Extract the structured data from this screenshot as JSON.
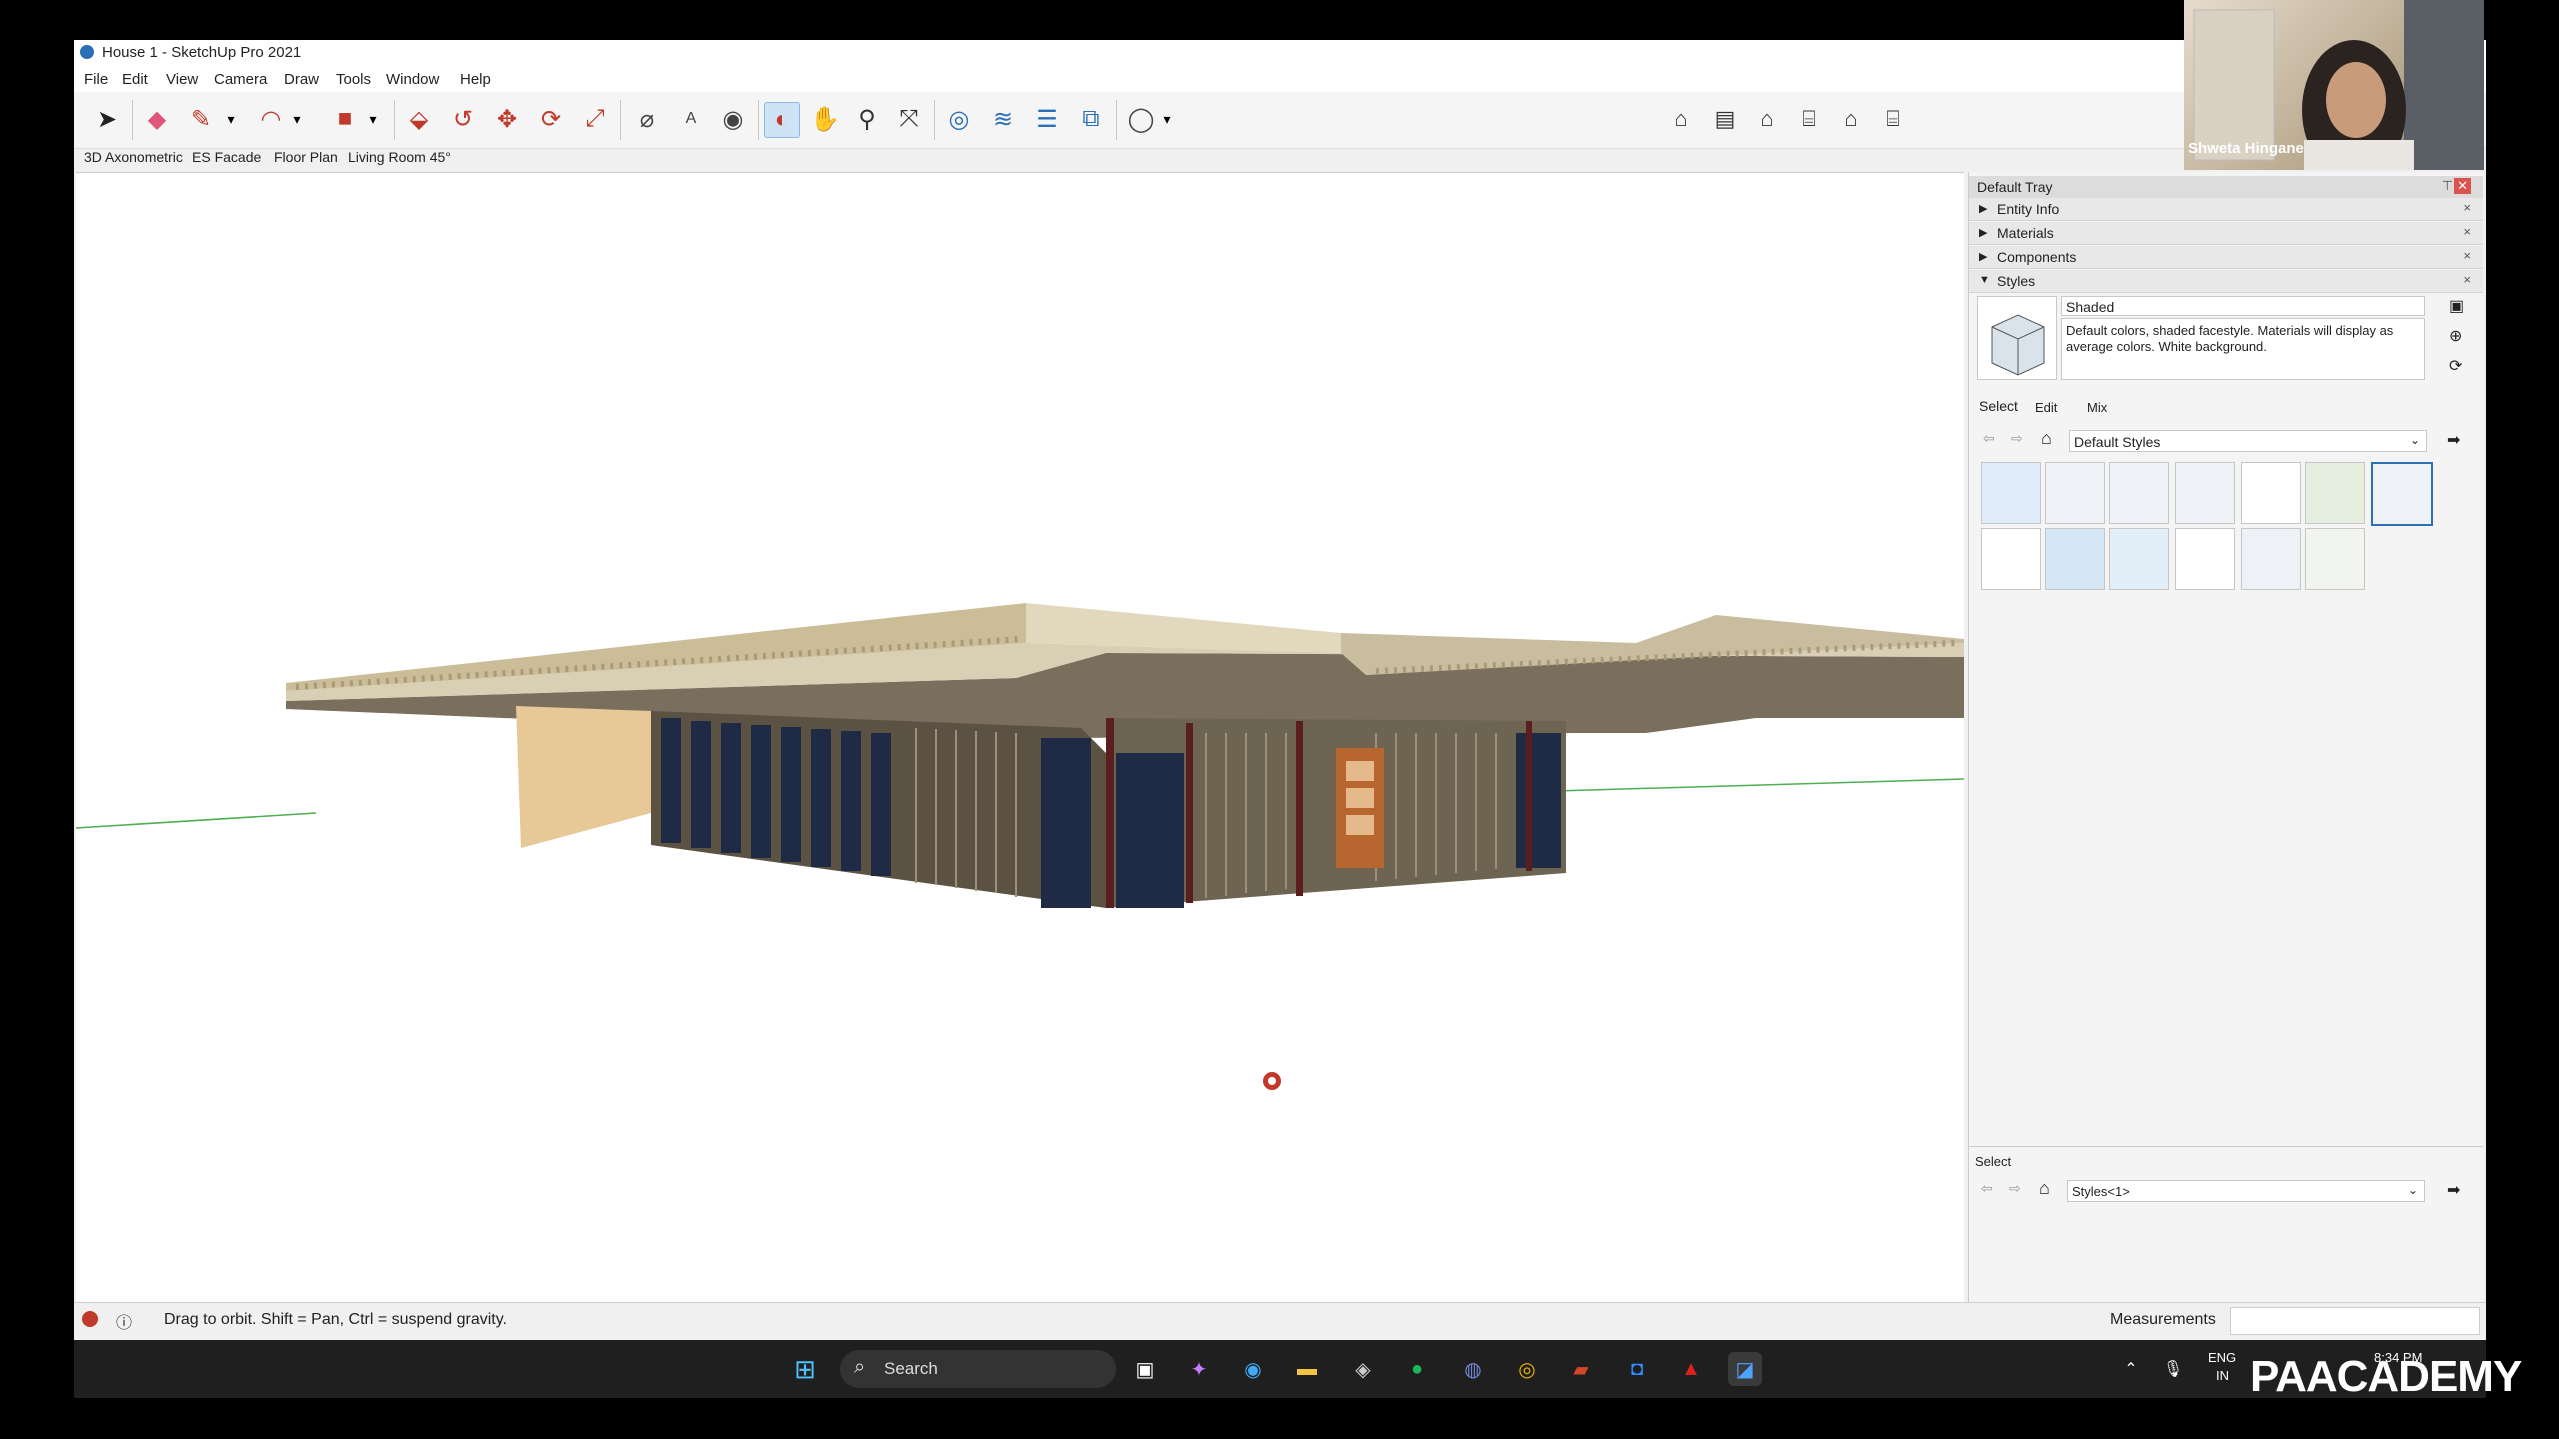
{
  "window": {
    "title": "House 1 - SketchUp Pro 2021"
  },
  "menu": [
    "File",
    "Edit",
    "View",
    "Camera",
    "Draw",
    "Tools",
    "Window",
    "Help"
  ],
  "scenes": [
    "3D Axonometric",
    "ES Facade",
    "Floor Plan",
    "Living Room 45°"
  ],
  "tray": {
    "title": "Default Tray",
    "panels": [
      "Entity Info",
      "Materials",
      "Components",
      "Styles"
    ],
    "style_name": "Shaded",
    "style_description": "Default colors, shaded facestyle.  Materials will display as average colors.  White background.",
    "tabs": [
      "Select",
      "Edit",
      "Mix"
    ],
    "library": "Default Styles",
    "lower_label": "Select",
    "lower_library": "Styles<1>"
  },
  "status": {
    "hint": "Drag to orbit. Shift = Pan, Ctrl = suspend gravity.",
    "measurements_label": "Measurements"
  },
  "taskbar": {
    "search_placeholder": "Search",
    "lang": "ENG",
    "region": "IN",
    "time": "8:34 PM"
  },
  "webcam": {
    "name": "Shweta Hingane"
  },
  "brand": "PAACADEMY",
  "colors": {
    "accent": "#2b6fb5",
    "selected": "#cfe3f7",
    "taskbar": "#1f1f1f"
  }
}
